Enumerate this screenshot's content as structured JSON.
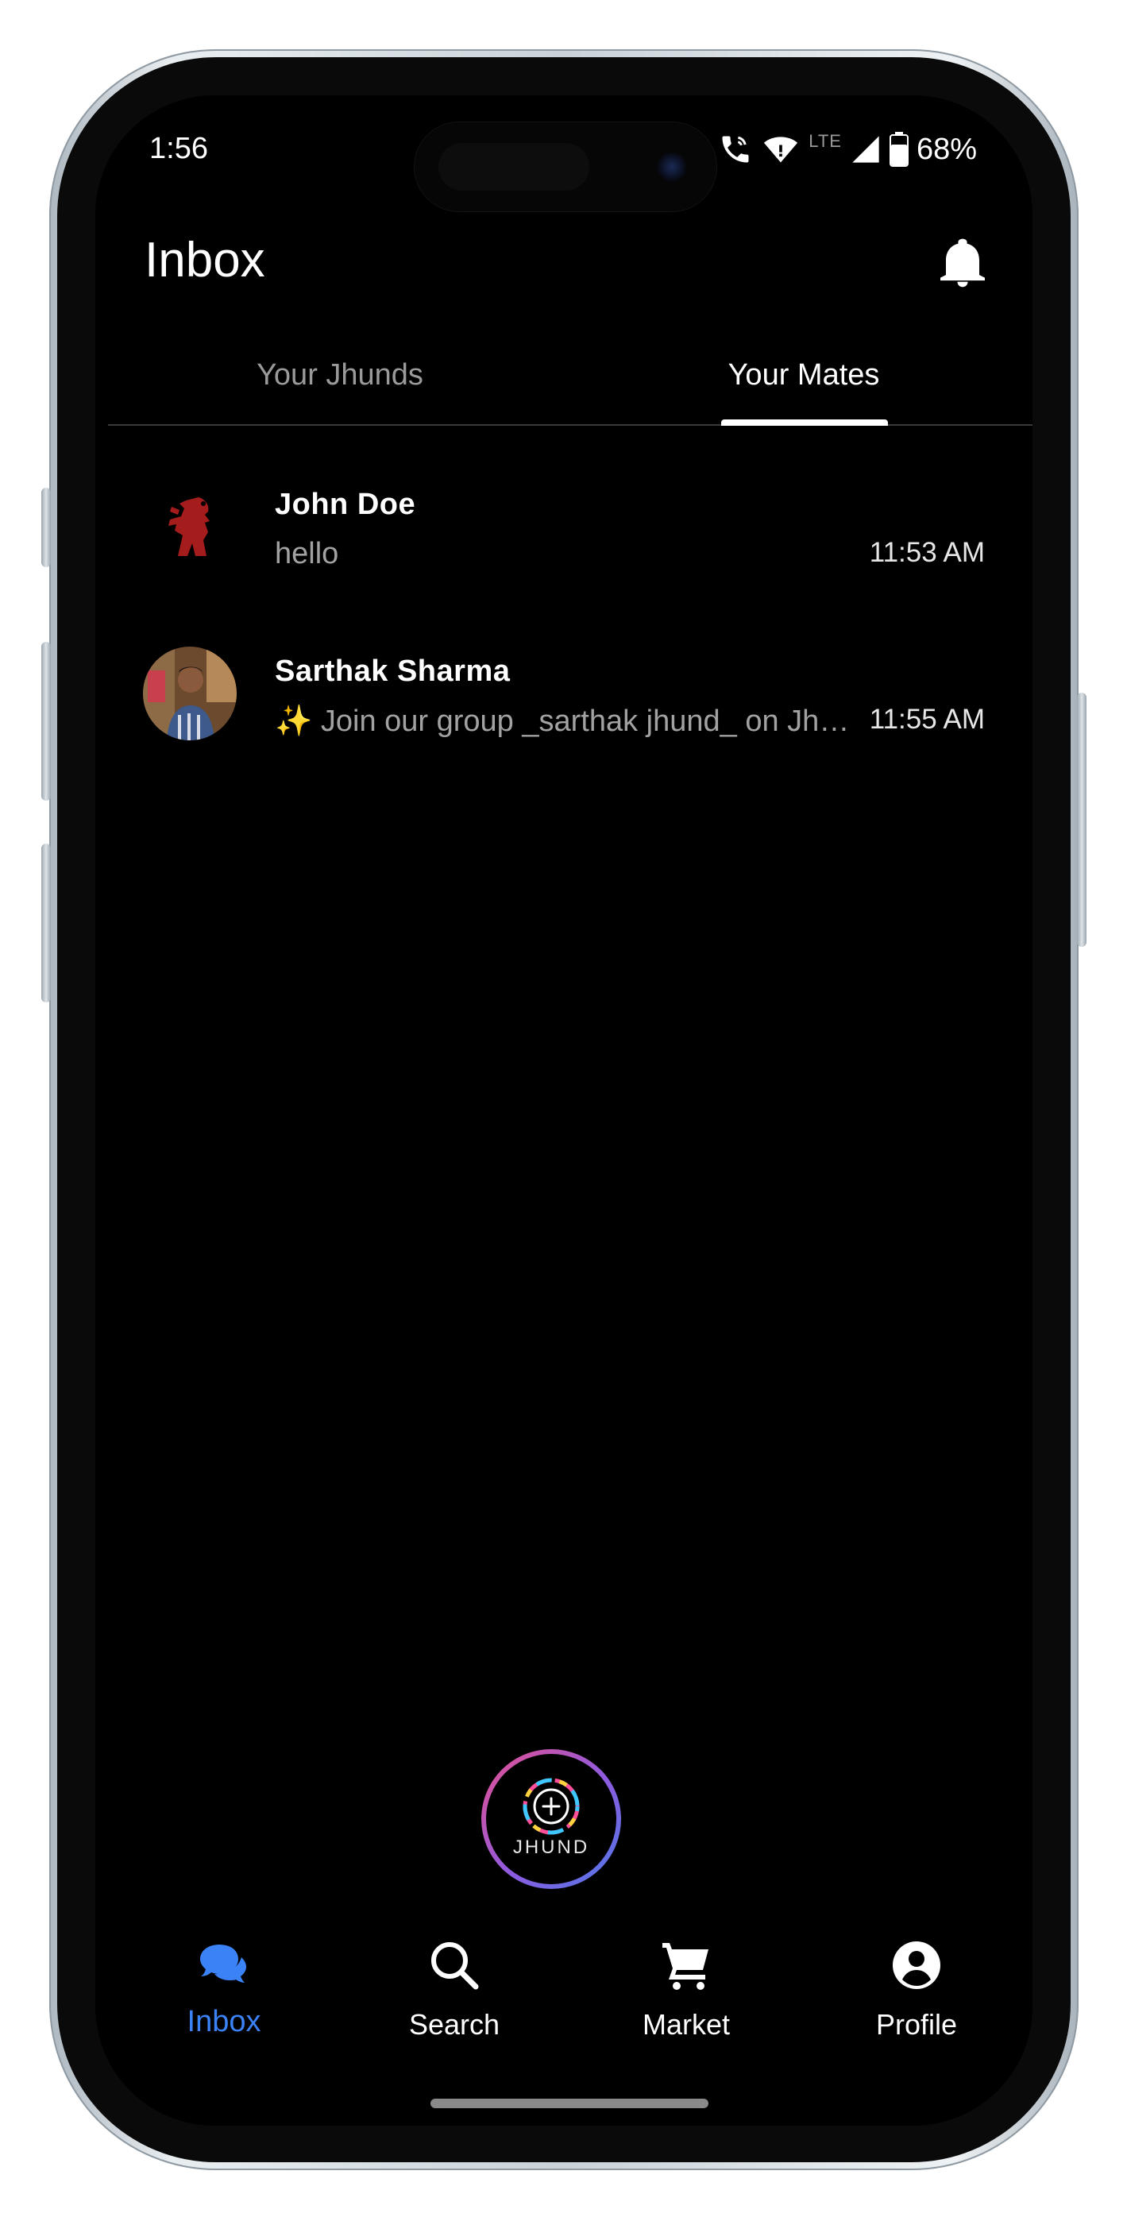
{
  "status_bar": {
    "time": "1:56",
    "network": "LTE",
    "battery": "68%",
    "icons": [
      "wifi-calling-icon",
      "wifi-icon",
      "cellular-signal-icon",
      "battery-icon"
    ]
  },
  "header": {
    "title": "Inbox",
    "notification_icon": "bell-icon"
  },
  "tabs": [
    {
      "label": "Your Jhunds",
      "selected": false
    },
    {
      "label": "Your Mates",
      "selected": true
    }
  ],
  "chats": [
    {
      "name": "John Doe",
      "preview": "hello",
      "time": "11:53 AM",
      "avatar": "red-figure-avatar"
    },
    {
      "name": "Sarthak Sharma",
      "preview": "✨ Join our group _sarthak jhund_ on Jhund",
      "time": "11:55 AM",
      "avatar": "photo-avatar"
    }
  ],
  "fab": {
    "label": "JHUND",
    "icon": "plus-icon"
  },
  "bottom_nav": [
    {
      "label": "Inbox",
      "icon": "chat-bubbles-icon",
      "active": true
    },
    {
      "label": "Search",
      "icon": "search-icon",
      "active": false
    },
    {
      "label": "Market",
      "icon": "cart-icon",
      "active": false
    },
    {
      "label": "Profile",
      "icon": "profile-icon",
      "active": false
    }
  ],
  "colors": {
    "background": "#000000",
    "accent": "#3b82f6",
    "muted_text": "#a2a2a2"
  }
}
